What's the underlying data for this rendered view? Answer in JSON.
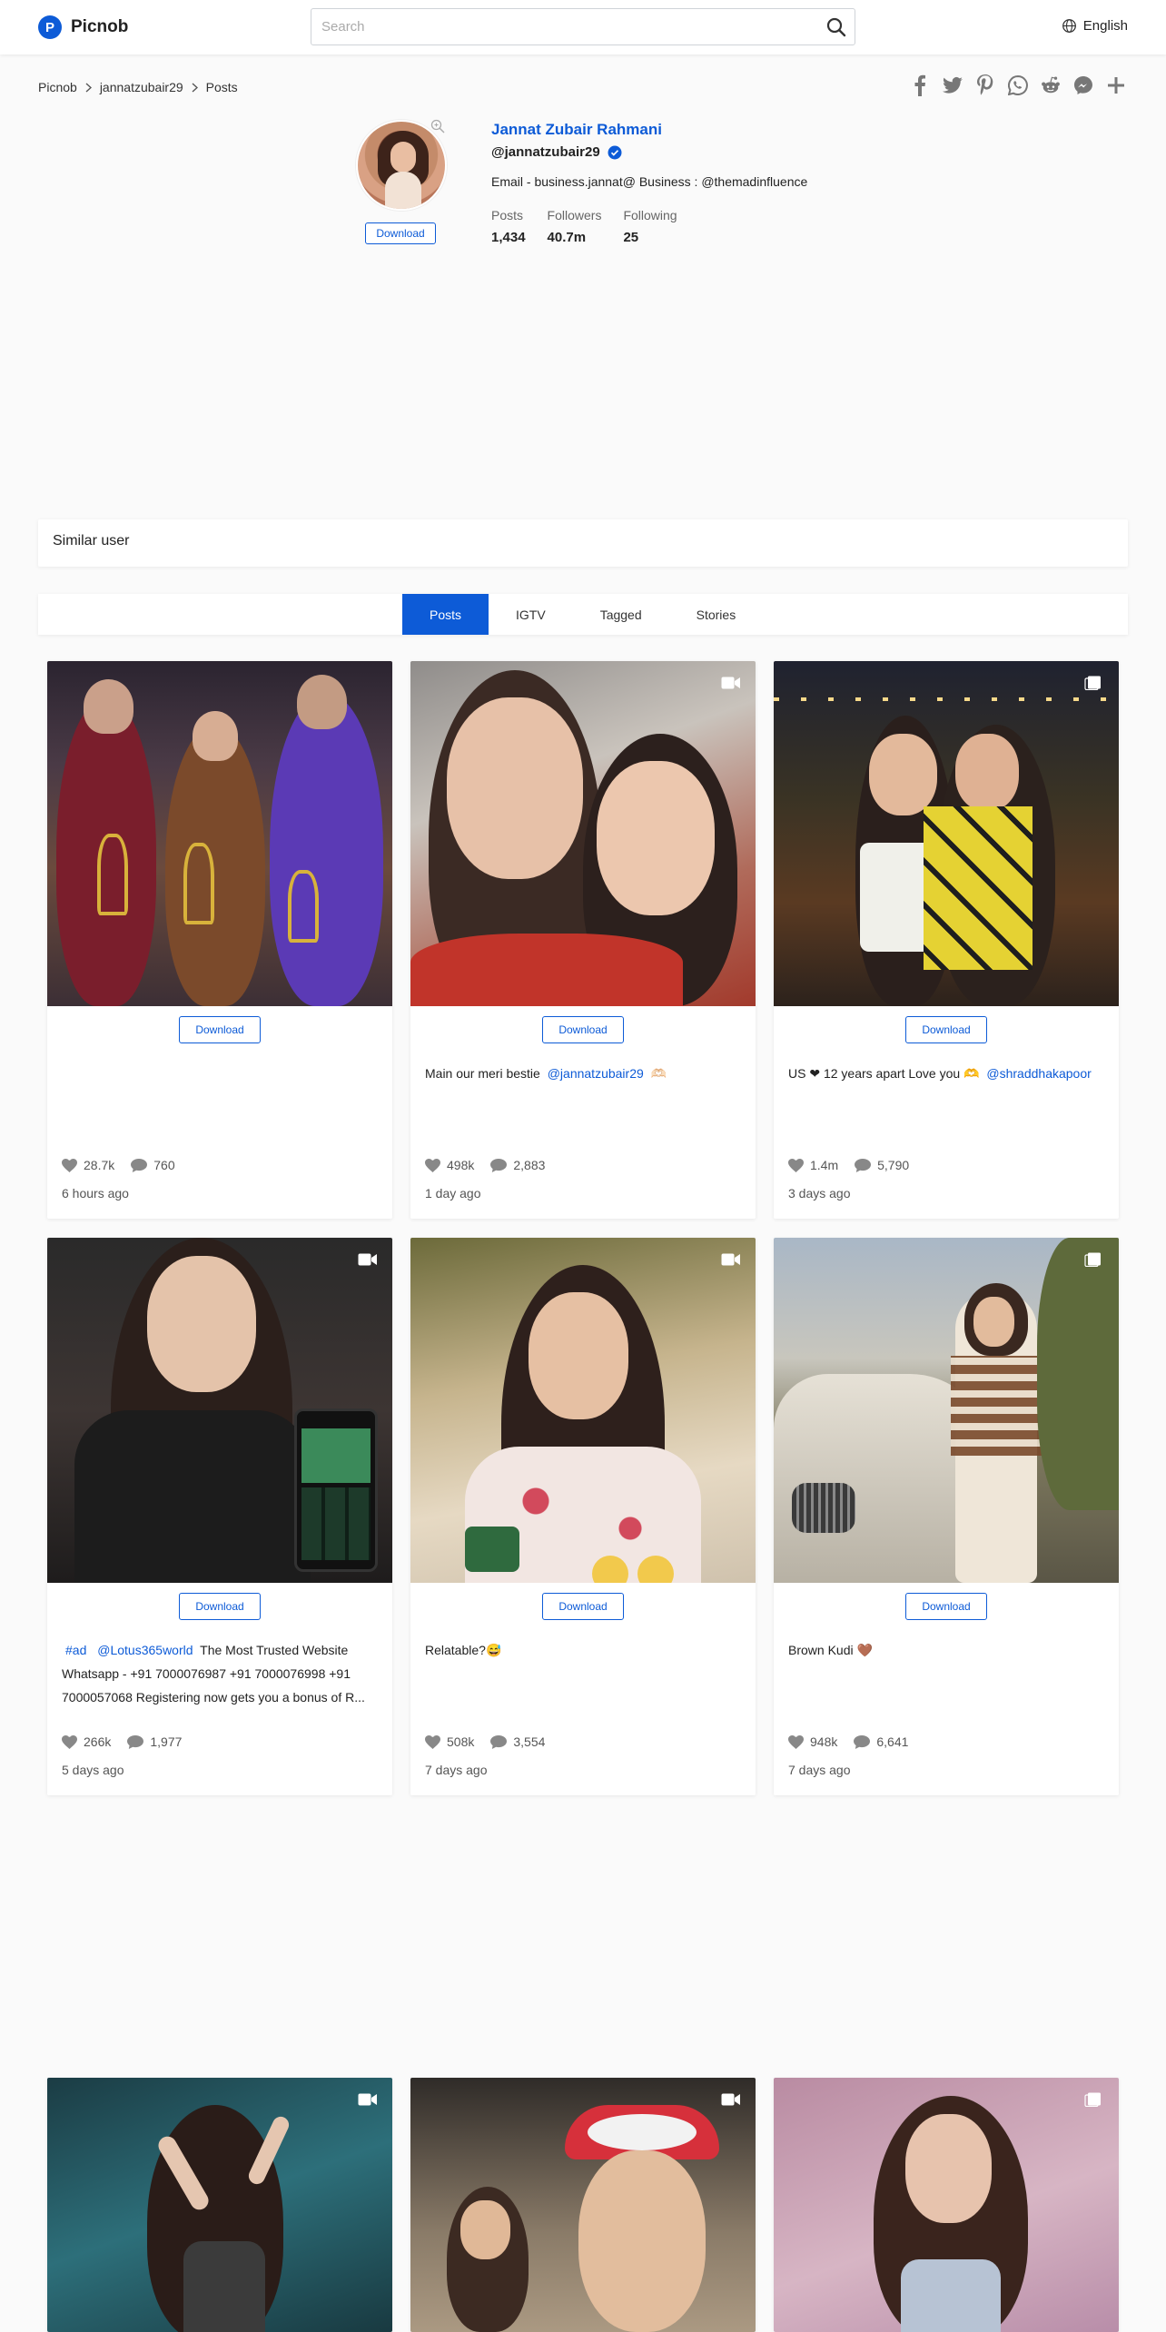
{
  "header": {
    "brand": "Picnob",
    "search_placeholder": "Search",
    "language": "English"
  },
  "breadcrumb": {
    "home": "Picnob",
    "user": "jannatzubair29",
    "current": "Posts"
  },
  "share_icons": [
    "facebook-icon",
    "twitter-icon",
    "pinterest-icon",
    "whatsapp-icon",
    "reddit-icon",
    "messenger-icon",
    "plus-icon"
  ],
  "profile": {
    "name": "Jannat Zubair Rahmani",
    "username": "@jannatzubair29",
    "bio": "Email - business.jannat@ Business : @themadinfluence",
    "download_label": "Download",
    "stats": [
      {
        "label": "Posts",
        "value": "1,434"
      },
      {
        "label": "Followers",
        "value": "40.7m"
      },
      {
        "label": "Following",
        "value": "25"
      }
    ]
  },
  "similar_user": {
    "label": "Similar user"
  },
  "tabs": [
    {
      "label": "Posts",
      "active": true
    },
    {
      "label": "IGTV",
      "active": false
    },
    {
      "label": "Tagged",
      "active": false
    },
    {
      "label": "Stories",
      "active": false
    }
  ],
  "posts": [
    {
      "download": "Download",
      "caption": "",
      "likes": "28.7k",
      "comments": "760",
      "time": "6 hours ago",
      "type_icon": "none"
    },
    {
      "download": "Download",
      "caption_text": "Main our meri bestie",
      "mention": "@jannatzubair29",
      "caption_tail": "🫶🏻",
      "likes": "498k",
      "comments": "2,883",
      "time": "1 day ago",
      "type_icon": "video-icon"
    },
    {
      "download": "Download",
      "caption_text": "US ❤ 12 years apart Love you 🫶",
      "mention": "@shraddhakapoor",
      "likes": "1.4m",
      "comments": "5,790",
      "time": "3 days ago",
      "type_icon": "gallery-icon"
    },
    {
      "download": "Download",
      "hashtag": "#ad",
      "mention": "@Lotus365world",
      "caption_text": "The Most Trusted Website Whatsapp - +91 7000076987 +91 7000076998 +91 7000057068 Registering now gets you a bonus of R...",
      "likes": "266k",
      "comments": "1,977",
      "time": "5 days ago",
      "type_icon": "video-icon"
    },
    {
      "download": "Download",
      "caption_text": "Relatable?😅",
      "likes": "508k",
      "comments": "3,554",
      "time": "7 days ago",
      "type_icon": "video-icon"
    },
    {
      "download": "Download",
      "caption_text": "Brown Kudi 🤎",
      "likes": "948k",
      "comments": "6,641",
      "time": "7 days ago",
      "type_icon": "gallery-icon"
    }
  ],
  "colors": {
    "accent": "#0d5bd7",
    "background": "#fafafa"
  }
}
